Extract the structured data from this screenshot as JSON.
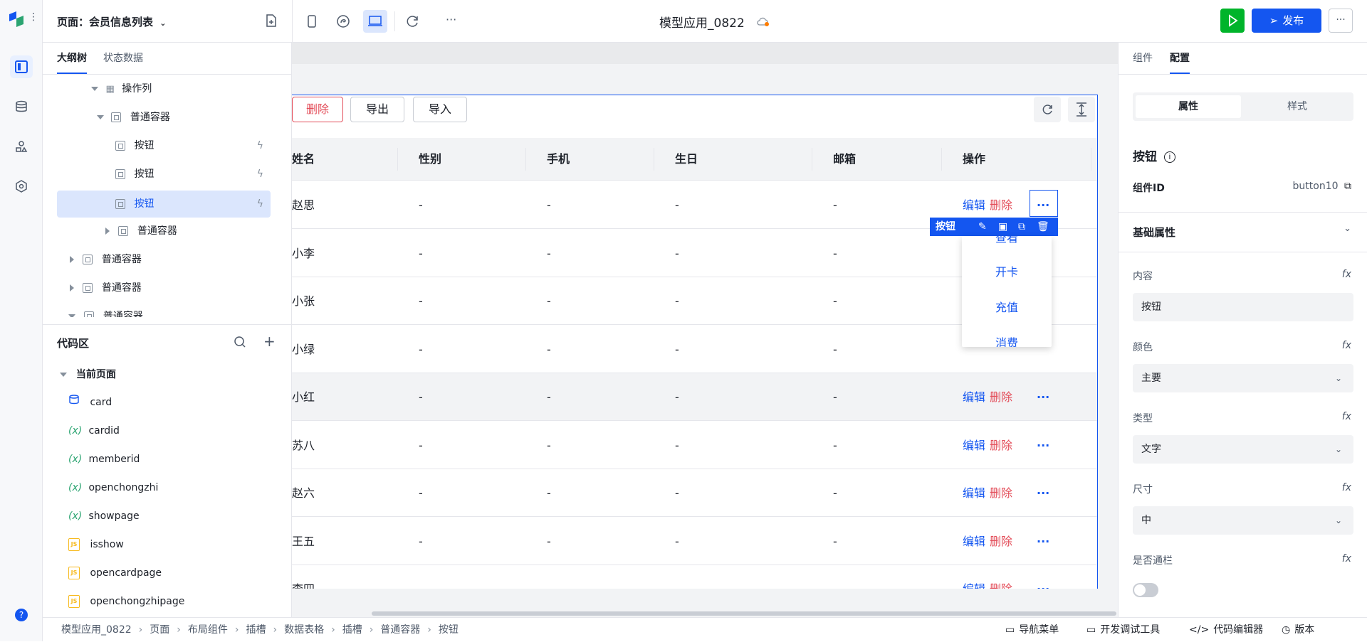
{
  "app": {
    "page_selector": "页面：会员信息列表",
    "app_name": "模型应用_0822",
    "publish_label": "发布"
  },
  "left_panel": {
    "tabs": [
      "大纲树",
      "状态数据"
    ],
    "tree": [
      {
        "label": "操作列"
      },
      {
        "label": "普通容器"
      },
      {
        "label": "按钮"
      },
      {
        "label": "按钮"
      },
      {
        "label": "按钮"
      },
      {
        "label": "普通容器"
      },
      {
        "label": "普通容器"
      },
      {
        "label": "普通容器"
      },
      {
        "label": "普通容器"
      }
    ],
    "code_area": {
      "title": "代码区",
      "current_page": "当前页面",
      "items": [
        {
          "label": "card",
          "icon": "database-icon"
        },
        {
          "label": "cardid",
          "icon": "variable-icon"
        },
        {
          "label": "memberid",
          "icon": "variable-icon"
        },
        {
          "label": "openchongzhi",
          "icon": "variable-icon"
        },
        {
          "label": "showpage",
          "icon": "variable-icon"
        },
        {
          "label": "isshow",
          "icon": "js-file-icon"
        },
        {
          "label": "opencardpage",
          "icon": "js-file-icon"
        },
        {
          "label": "openchongzhipage",
          "icon": "js-file-icon"
        }
      ],
      "var_glyph": "(x)",
      "js_glyph": "JS"
    }
  },
  "canvas": {
    "toolbar_buttons": [
      "删除",
      "导出",
      "导入"
    ],
    "columns": [
      "姓名",
      "性别",
      "手机",
      "生日",
      "邮箱",
      "操作"
    ],
    "rows": [
      {
        "name": "赵思",
        "gender": "-",
        "phone": "-",
        "birthday": "-",
        "email": "-"
      },
      {
        "name": "小李",
        "gender": "-",
        "phone": "-",
        "birthday": "-",
        "email": "-"
      },
      {
        "name": "小张",
        "gender": "-",
        "phone": "-",
        "birthday": "-",
        "email": "-"
      },
      {
        "name": "小绿",
        "gender": "-",
        "phone": "-",
        "birthday": "-",
        "email": "-"
      },
      {
        "name": "小红",
        "gender": "-",
        "phone": "-",
        "birthday": "-",
        "email": "-"
      },
      {
        "name": "苏八",
        "gender": "-",
        "phone": "-",
        "birthday": "-",
        "email": "-"
      },
      {
        "name": "赵六",
        "gender": "-",
        "phone": "-",
        "birthday": "-",
        "email": "-"
      },
      {
        "name": "王五",
        "gender": "-",
        "phone": "-",
        "birthday": "-",
        "email": "-"
      },
      {
        "name": "李四",
        "gender": "-",
        "phone": "-",
        "birthday": "-",
        "email": "-"
      }
    ],
    "edit_label": "编辑",
    "delete_label": "删除",
    "more_label": "···",
    "selected_tag": "按钮",
    "dropdown": [
      "查看",
      "开卡",
      "充值",
      "消费"
    ]
  },
  "right_panel": {
    "tabs": [
      "组件",
      "配置"
    ],
    "segments": [
      "属性",
      "样式"
    ],
    "component_title": "按钮",
    "component_id_label": "组件ID",
    "component_id": "button10",
    "section_title": "基础属性",
    "fx_label": "fx",
    "fields": [
      {
        "label": "内容",
        "value": "按钮"
      },
      {
        "label": "颜色",
        "value": "主要"
      },
      {
        "label": "类型",
        "value": "文字"
      },
      {
        "label": "尺寸",
        "value": "中"
      }
    ],
    "toggle_label": "是否通栏",
    "toggle_on": false
  },
  "status_bar": {
    "breadcrumb": [
      "模型应用_0822",
      "页面",
      "布局组件",
      "插槽",
      "数据表格",
      "插槽",
      "普通容器",
      "按钮"
    ],
    "nav_menu": "导航菜单",
    "dev_tools": "开发调试工具",
    "code_editor": "代码编辑器",
    "version": "版本"
  },
  "colors": {
    "accent": "#1456f0",
    "danger": "#e34d59",
    "run_green": "#00b42a"
  }
}
